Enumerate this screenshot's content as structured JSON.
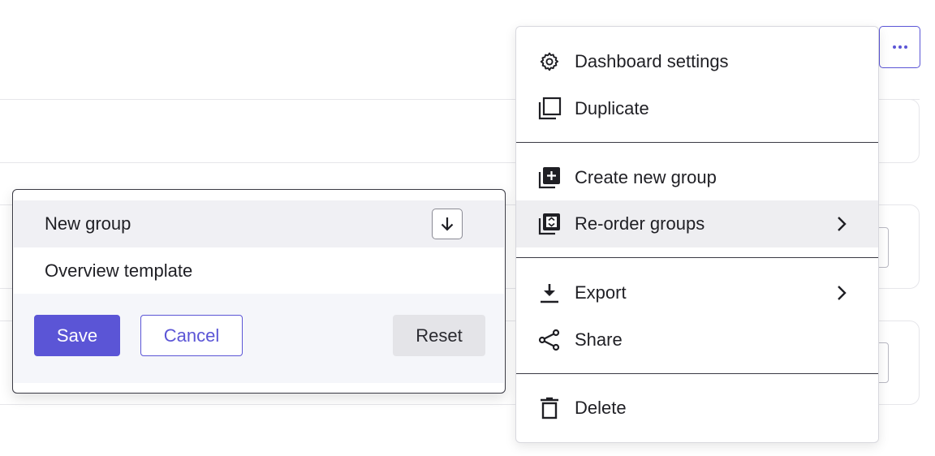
{
  "header": {
    "more_button_label": "More actions"
  },
  "menu": {
    "items": [
      {
        "label": "Dashboard settings",
        "icon": "gear-icon"
      },
      {
        "label": "Duplicate",
        "icon": "duplicate-icon"
      },
      {
        "label": "Create new group",
        "icon": "add-group-icon"
      },
      {
        "label": "Re-order groups",
        "icon": "reorder-groups-icon",
        "submenu": true,
        "active": true
      },
      {
        "label": "Export",
        "icon": "download-icon",
        "submenu": true
      },
      {
        "label": "Share",
        "icon": "share-icon"
      },
      {
        "label": "Delete",
        "icon": "trash-icon"
      }
    ]
  },
  "reorder_popover": {
    "groups": [
      {
        "label": "New group",
        "selected": true
      },
      {
        "label": "Overview template",
        "selected": false
      }
    ],
    "move_down_icon": "arrow-down-icon",
    "save_label": "Save",
    "cancel_label": "Cancel",
    "reset_label": "Reset"
  },
  "colors": {
    "accent": "#5b55d6",
    "active_row": "#eeeef1",
    "footer_bg": "#f5f6fa"
  }
}
